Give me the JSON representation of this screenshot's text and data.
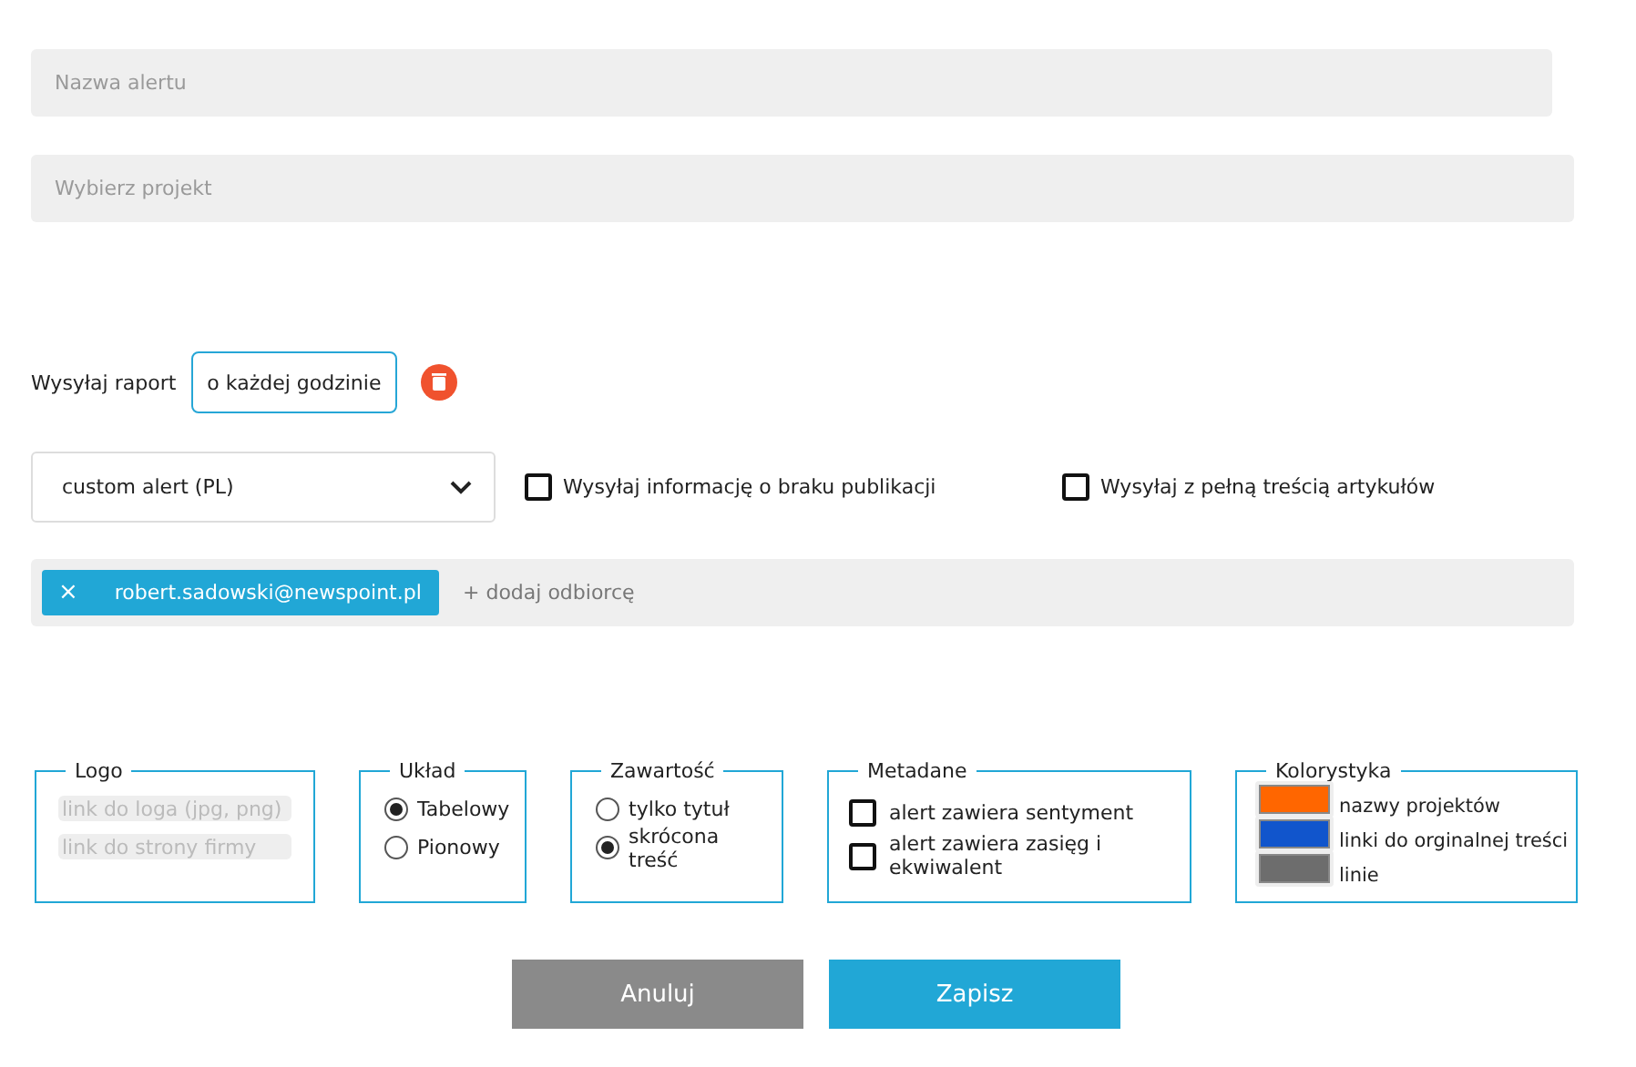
{
  "alert_name": {
    "placeholder": "Nazwa alertu"
  },
  "project": {
    "placeholder": "Wybierz projekt"
  },
  "schedule": {
    "label": "Wysyłaj raport",
    "value": "o każdej godzinie"
  },
  "template_select": {
    "value": "custom alert (PL)"
  },
  "options": [
    {
      "label": "Wysyłaj informację o braku publikacji",
      "checked": false
    },
    {
      "label": "Wysyłaj z pełną treścią artykułów",
      "checked": false
    }
  ],
  "recipients": {
    "tags": [
      {
        "remove": "×",
        "email": "robert.sadowski@newspoint.pl"
      }
    ],
    "add_label": "+ dodaj odbiorcę"
  },
  "logo": {
    "legend": "Logo",
    "fields": [
      {
        "placeholder": "link do loga (jpg, png)"
      },
      {
        "placeholder": "link do strony firmy"
      }
    ]
  },
  "layout": {
    "legend": "Układ",
    "options": [
      {
        "label": "Tabelowy",
        "selected": true
      },
      {
        "label": "Pionowy",
        "selected": false
      }
    ]
  },
  "content": {
    "legend": "Zawartość",
    "options": [
      {
        "label": "tylko tytuł",
        "selected": false
      },
      {
        "label": "skrócona treść",
        "selected": true
      }
    ]
  },
  "metadata": {
    "legend": "Metadane",
    "options": [
      {
        "label": "alert zawiera sentyment",
        "checked": false
      },
      {
        "label": "alert zawiera zasięg i ekwiwalent",
        "checked": false
      }
    ]
  },
  "colors": {
    "legend": "Kolorystyka",
    "items": [
      {
        "label": "nazwy projektów",
        "color": "#ff6600"
      },
      {
        "label": "linki do orginalnej treści",
        "color": "#1155cc"
      },
      {
        "label": "linie",
        "color": "#6d6d6d"
      }
    ]
  },
  "buttons": [
    {
      "label": "Anuluj",
      "kind": "cancel"
    },
    {
      "label": "Zapisz",
      "kind": "save"
    }
  ]
}
